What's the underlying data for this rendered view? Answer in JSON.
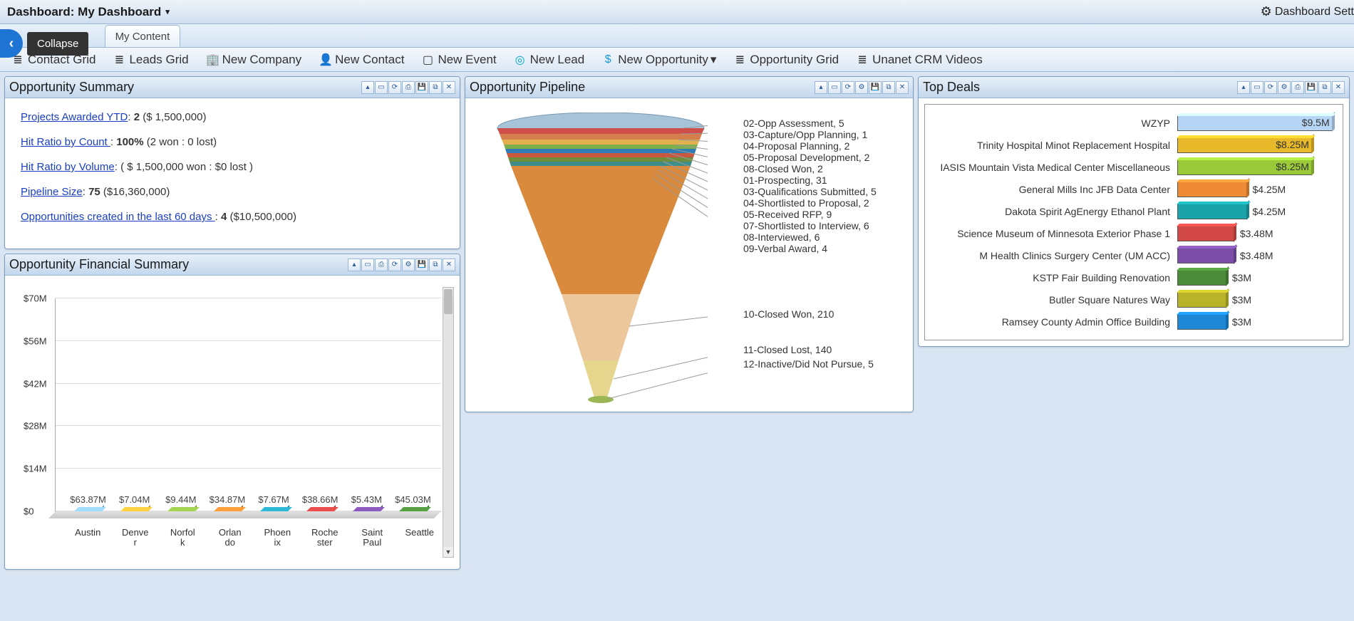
{
  "header": {
    "title": "Dashboard: My Dashboard",
    "settings_label": "Dashboard Sett"
  },
  "collapse": {
    "label": "Collapse"
  },
  "tabs": [
    {
      "label": "My Content",
      "active": false
    }
  ],
  "toolbar": [
    {
      "label": "Contact Grid",
      "icon": "list"
    },
    {
      "label": "Leads Grid",
      "icon": "list"
    },
    {
      "label": "New Company",
      "icon": "building",
      "color": "#e67a2e"
    },
    {
      "label": "New Contact",
      "icon": "person",
      "color": "#f5a623"
    },
    {
      "label": "New Event",
      "icon": "calendar"
    },
    {
      "label": "New Lead",
      "icon": "target",
      "color": "#00a6c7"
    },
    {
      "label": "New Opportunity",
      "icon": "dollar",
      "color": "#1e9ad6",
      "caret": true
    },
    {
      "label": "Opportunity Grid",
      "icon": "list"
    },
    {
      "label": "Unanet CRM Videos",
      "icon": "list"
    }
  ],
  "widgets": {
    "opp_summary": {
      "title": "Opportunity Summary",
      "lines": {
        "projects_awarded": {
          "link": "Projects Awarded YTD",
          "sep": ": ",
          "bold": "2",
          "rest": " ($ 1,500,000)"
        },
        "hit_ratio_count": {
          "link": "Hit Ratio by Count ",
          "sep": ": ",
          "bold": "100%",
          "rest": " (2 won : 0 lost)"
        },
        "hit_ratio_volume": {
          "link": "Hit Ratio by Volume",
          "sep": ": ",
          "bold": "",
          "rest": "( $ 1,500,000 won : $0 lost )"
        },
        "pipeline_size": {
          "link": "Pipeline Size",
          "sep": ": ",
          "bold": "75",
          "rest": " ($16,360,000)"
        },
        "opps_60d": {
          "link": "Opportunities created in the last 60 days ",
          "sep": ": ",
          "bold": "4",
          "rest": " ($10,500,000)"
        }
      }
    },
    "fin_summary": {
      "title": "Opportunity Financial Summary"
    },
    "pipeline": {
      "title": "Opportunity Pipeline"
    },
    "top_deals": {
      "title": "Top Deals"
    }
  },
  "chart_data": [
    {
      "id": "financial_summary_bar",
      "type": "bar",
      "categories": [
        "Austin",
        "Denver",
        "Norfolk",
        "Orlando",
        "Phoenix",
        "Rochester",
        "Saint Paul",
        "Seattle"
      ],
      "series": [
        {
          "name": "primary",
          "values": [
            63.87,
            7.04,
            9.44,
            34.87,
            7.67,
            38.66,
            5.43,
            45.03
          ],
          "labels": [
            "$63.87M",
            "$7.04M",
            "$9.44M",
            "$34.87M",
            "$7.67M",
            "$38.66M",
            "$5.43M",
            "$45.03M"
          ],
          "colors": [
            "#8ec0ef",
            "#e6b738",
            "#8eb947",
            "#ef8a34",
            "#2aa1bb",
            "#cc4441",
            "#7b4ea8",
            "#4c8b3a"
          ]
        }
      ],
      "ylabel": "",
      "yticks": [
        "$0",
        "$14M",
        "$28M",
        "$42M",
        "$56M",
        "$70M"
      ],
      "ylim": [
        0,
        70
      ]
    },
    {
      "id": "pipeline_funnel",
      "type": "funnel",
      "stages": [
        {
          "label": "02-Opp Assessment",
          "value": 5
        },
        {
          "label": "03-Capture/Opp Planning",
          "value": 1
        },
        {
          "label": "04-Proposal Planning",
          "value": 2
        },
        {
          "label": "05-Proposal Development",
          "value": 2
        },
        {
          "label": "08-Closed Won",
          "value": 2
        },
        {
          "label": "01-Prospecting",
          "value": 31
        },
        {
          "label": "03-Qualifications Submitted",
          "value": 5
        },
        {
          "label": "04-Shortlisted to Proposal",
          "value": 2
        },
        {
          "label": "05-Received RFP",
          "value": 9
        },
        {
          "label": "07-Shortlisted to Interview",
          "value": 6
        },
        {
          "label": "08-Interviewed",
          "value": 6
        },
        {
          "label": "09-Verbal Award",
          "value": 4
        },
        {
          "label": "10-Closed Won",
          "value": 210
        },
        {
          "label": "11-Closed Lost",
          "value": 140
        },
        {
          "label": "12-Inactive/Did Not Pursue",
          "value": 5
        }
      ]
    },
    {
      "id": "top_deals_hbar",
      "type": "bar",
      "orientation": "horizontal",
      "categories": [
        "WZYP",
        "Trinity Hospital Minot Replacement Hospital",
        "IASIS Mountain Vista Medical Center Miscellaneous",
        "General Mills Inc JFB Data Center",
        "Dakota Spirit AgEnergy Ethanol Plant",
        "Science Museum of Minnesota Exterior Phase 1",
        "M Health Clinics Surgery Center (UM ACC)",
        "KSTP Fair Building Renovation",
        "Butler Square Natures Way",
        "Ramsey County Admin Office Building"
      ],
      "values": [
        9.5,
        8.25,
        8.25,
        4.25,
        4.25,
        3.48,
        3.48,
        3,
        3,
        3
      ],
      "value_labels": [
        "$9.5M",
        "$8.25M",
        "$8.25M",
        "$4.25M",
        "$4.25M",
        "$3.48M",
        "$3.48M",
        "$3M",
        "$3M",
        "$3M"
      ],
      "colors": [
        "#b6d4f4",
        "#e8b92b",
        "#9ac93a",
        "#ef8a34",
        "#1aa3a8",
        "#d24846",
        "#7b4ea8",
        "#4c8b3a",
        "#b9b32a",
        "#1e87d6"
      ],
      "xlim": [
        0,
        9.5
      ]
    }
  ]
}
